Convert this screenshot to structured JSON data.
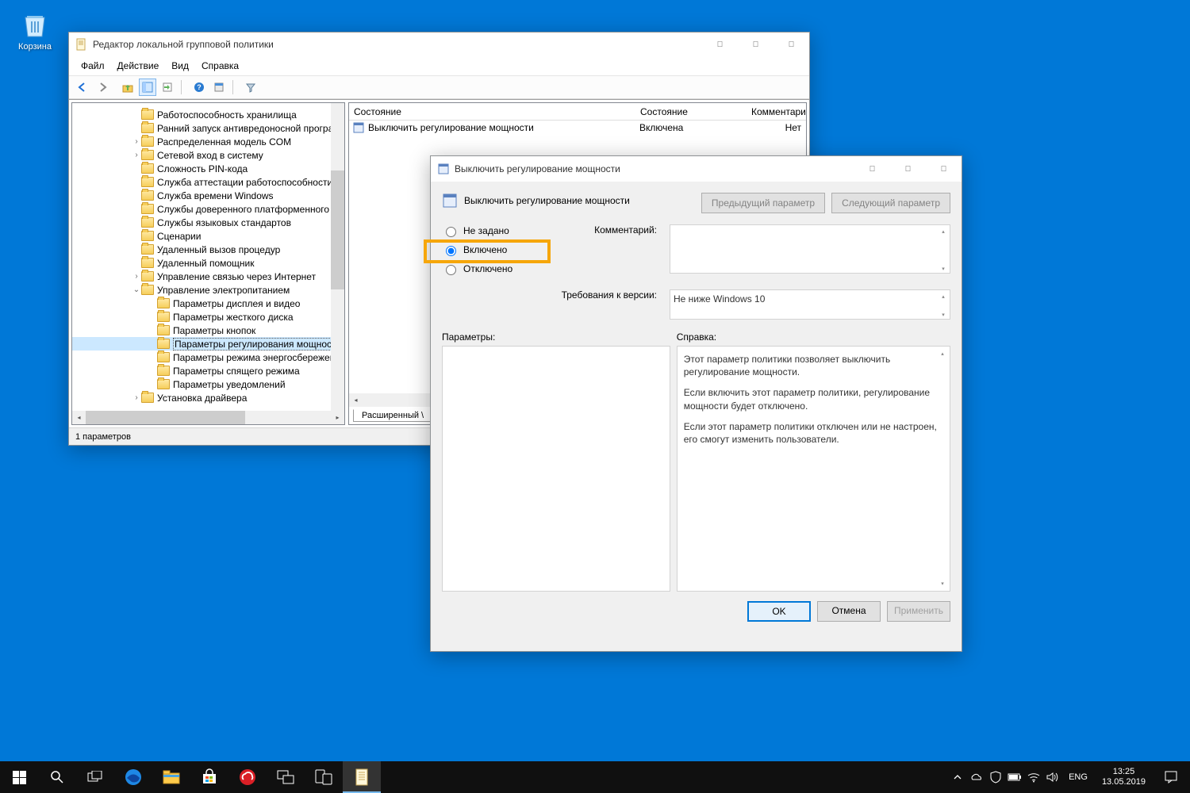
{
  "desktop": {
    "recycle_bin": "Корзина"
  },
  "gp_window": {
    "title": "Редактор локальной групповой политики",
    "menus": {
      "file": "Файл",
      "action": "Действие",
      "view": "Вид",
      "help": "Справка"
    },
    "tree": {
      "items": [
        {
          "indent": 75,
          "exp": "",
          "label": "Работоспособность хранилища"
        },
        {
          "indent": 75,
          "exp": "",
          "label": "Ранний запуск антивредоносной программы"
        },
        {
          "indent": 75,
          "exp": "›",
          "label": "Распределенная модель COM"
        },
        {
          "indent": 75,
          "exp": "›",
          "label": "Сетевой вход в систему"
        },
        {
          "indent": 75,
          "exp": "",
          "label": "Сложность PIN-кода"
        },
        {
          "indent": 75,
          "exp": "",
          "label": "Служба аттестации работоспособности устр"
        },
        {
          "indent": 75,
          "exp": "",
          "label": "Служба времени Windows"
        },
        {
          "indent": 75,
          "exp": "",
          "label": "Службы доверенного платформенного моду"
        },
        {
          "indent": 75,
          "exp": "",
          "label": "Службы языковых стандартов"
        },
        {
          "indent": 75,
          "exp": "",
          "label": "Сценарии"
        },
        {
          "indent": 75,
          "exp": "",
          "label": "Удаленный вызов процедур"
        },
        {
          "indent": 75,
          "exp": "",
          "label": "Удаленный помощник"
        },
        {
          "indent": 75,
          "exp": "›",
          "label": "Управление связью через Интернет"
        },
        {
          "indent": 75,
          "exp": "⌄",
          "label": "Управление электропитанием"
        },
        {
          "indent": 95,
          "exp": "",
          "label": "Параметры дисплея и видео"
        },
        {
          "indent": 95,
          "exp": "",
          "label": "Параметры жесткого диска"
        },
        {
          "indent": 95,
          "exp": "",
          "label": "Параметры кнопок"
        },
        {
          "indent": 95,
          "exp": "",
          "label": "Параметры регулирования мощности",
          "selected": true
        },
        {
          "indent": 95,
          "exp": "",
          "label": "Параметры режима энергосбережения"
        },
        {
          "indent": 95,
          "exp": "",
          "label": "Параметры спящего режима"
        },
        {
          "indent": 95,
          "exp": "",
          "label": "Параметры уведомлений"
        },
        {
          "indent": 75,
          "exp": "›",
          "label": "Установка драйвера"
        }
      ]
    },
    "detail": {
      "col_state_label": "Состояние",
      "col_status_label": "Состояние",
      "col_comment_label": "Комментари",
      "row_name": "Выключить регулирование мощности",
      "row_state": "Включена",
      "row_comment": "Нет",
      "tab_extended": "Расширенный \\"
    },
    "status": "1 параметров"
  },
  "dialog": {
    "title": "Выключить регулирование мощности",
    "subtitle": "Выключить регулирование мощности",
    "prev_btn": "Предыдущий параметр",
    "next_btn": "Следующий параметр",
    "radio_not_configured": "Не задано",
    "radio_enabled": "Включено",
    "radio_disabled": "Отключено",
    "comment_label": "Комментарий:",
    "requirements_label": "Требования к версии:",
    "requirements_value": "Не ниже Windows 10",
    "params_label": "Параметры:",
    "help_label": "Справка:",
    "help_p1": "Этот параметр политики позволяет выключить регулирование мощности.",
    "help_p2": "Если включить этот параметр политики, регулирование мощности будет отключено.",
    "help_p3": "Если этот параметр политики отключен или не настроен, его смогут изменить пользователи.",
    "btn_ok": "OK",
    "btn_cancel": "Отмена",
    "btn_apply": "Применить"
  },
  "taskbar": {
    "time": "13:25",
    "date": "13.05.2019",
    "lang": "ENG"
  }
}
